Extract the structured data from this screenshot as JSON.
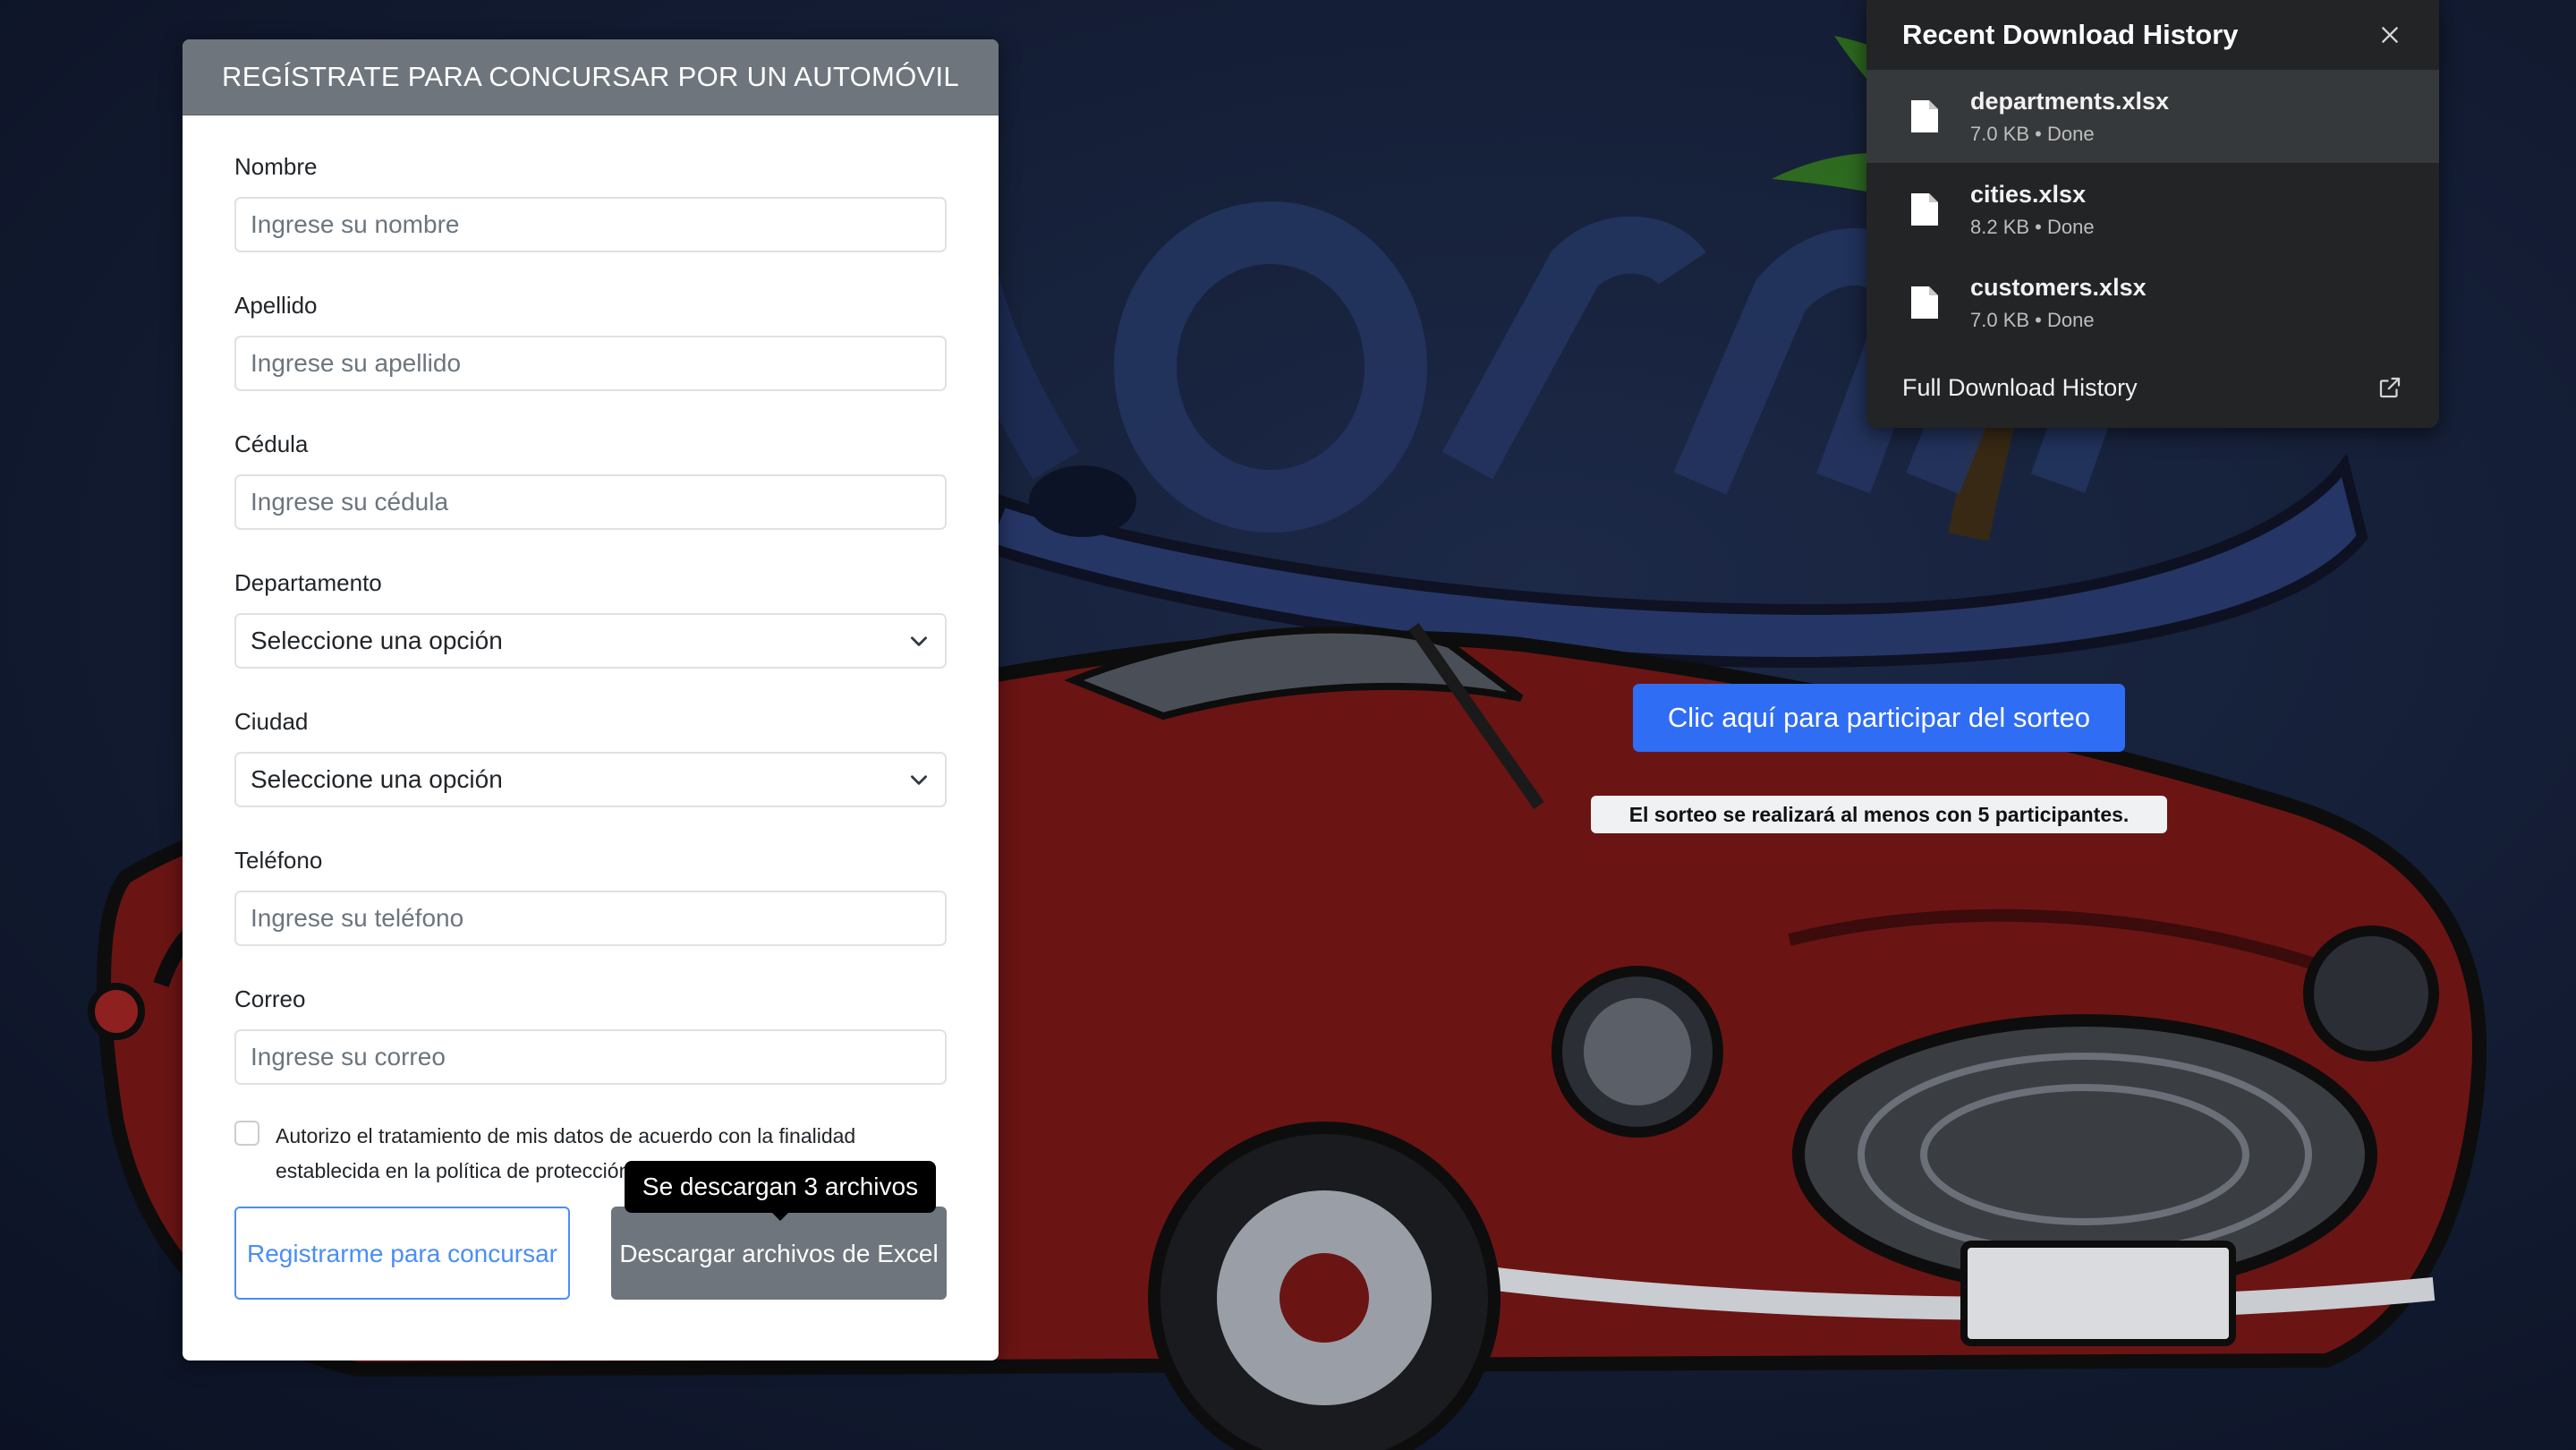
{
  "form": {
    "header": "REGÍSTRATE PARA CONCURSAR POR UN AUTOMÓVIL",
    "fields": {
      "nombre": {
        "label": "Nombre",
        "placeholder": "Ingrese su nombre"
      },
      "apellido": {
        "label": "Apellido",
        "placeholder": "Ingrese su apellido"
      },
      "cedula": {
        "label": "Cédula",
        "placeholder": "Ingrese su cédula"
      },
      "departamento": {
        "label": "Departamento",
        "value": "Seleccione una opción"
      },
      "ciudad": {
        "label": "Ciudad",
        "value": "Seleccione una opción"
      },
      "telefono": {
        "label": "Teléfono",
        "placeholder": "Ingrese su teléfono"
      },
      "correo": {
        "label": "Correo",
        "placeholder": "Ingrese su correo"
      }
    },
    "consent_line1": "Autorizo el tratamiento de mis datos de acuerdo con la finalidad",
    "consent_line2": "establecida en la política de protección de datos personales.",
    "register_button": "Registrarme para concursar",
    "download_button": "Descargar archivos de Excel",
    "tooltip": "Se descargan 3 archivos"
  },
  "cta": {
    "label": "Clic aquí para participar del sorteo",
    "note": "El sorteo se realizará al menos con 5 participantes."
  },
  "downloads": {
    "title": "Recent Download History",
    "items": [
      {
        "name": "departments.xlsx",
        "meta": "7.0 KB • Done"
      },
      {
        "name": "cities.xlsx",
        "meta": "8.2 KB • Done"
      },
      {
        "name": "customers.xlsx",
        "meta": "7.0 KB • Done"
      }
    ],
    "footer": "Full Download History",
    "icons": {
      "close": "close-icon",
      "file": "file-icon",
      "external": "external-link-icon"
    }
  },
  "colors": {
    "primary": "#2f6df4",
    "header_gray": "#6e757c",
    "panel_bg": "#222426"
  }
}
